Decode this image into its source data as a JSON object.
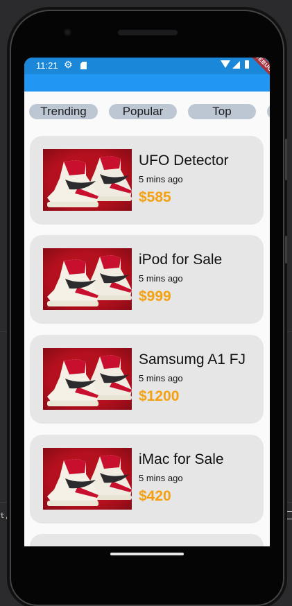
{
  "status_bar": {
    "time": "11:21",
    "debug_label": "DEBUG"
  },
  "chips": [
    {
      "label": "Trending"
    },
    {
      "label": "Popular"
    },
    {
      "label": "Top"
    },
    {
      "label": ""
    }
  ],
  "products": [
    {
      "title": "UFO Detector",
      "time": "5 mins ago",
      "price": "$585",
      "image": "sneaker-photo"
    },
    {
      "title": "iPod for Sale",
      "time": "5 mins ago",
      "price": "$999",
      "image": "sneaker-photo"
    },
    {
      "title": "Samsumg A1 FJ",
      "time": "5 mins ago",
      "price": "$1200",
      "image": "sneaker-photo"
    },
    {
      "title": "iMac for Sale",
      "time": "5 mins ago",
      "price": "$420",
      "image": "sneaker-photo"
    }
  ],
  "colors": {
    "status_bar": "#1a87d9",
    "app_bar": "#2196f3",
    "chip_bg": "#bcc7d3",
    "card_bg": "#e6e6e6",
    "price": "#f5a00e"
  },
  "background": {
    "left_text": "t,",
    "right_icon": "list-icon"
  }
}
